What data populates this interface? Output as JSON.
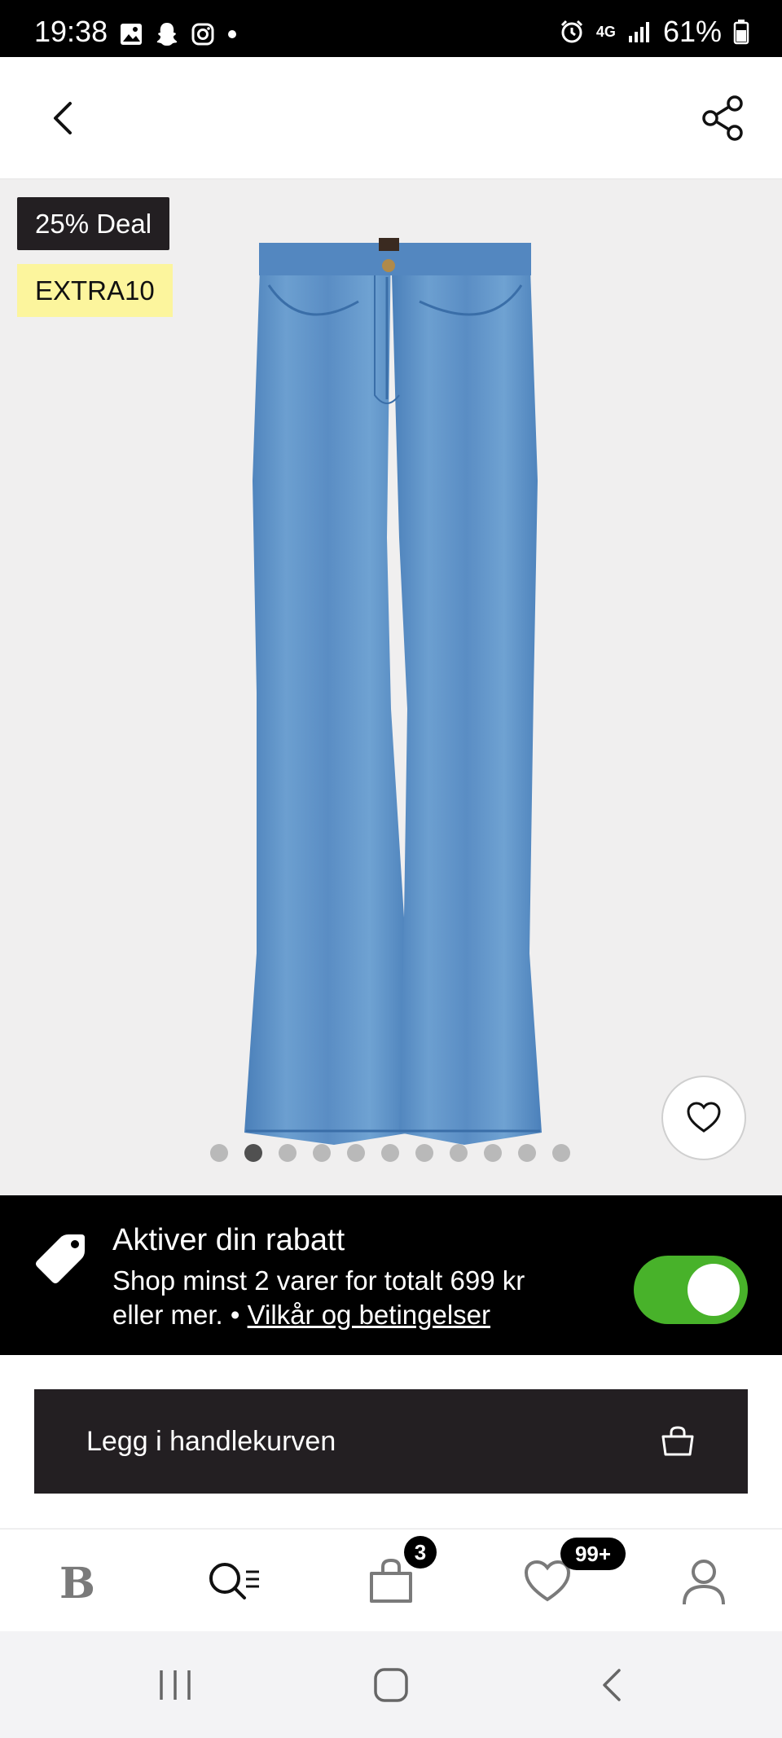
{
  "status_bar": {
    "time": "19:38",
    "network": "4G",
    "battery": "61%"
  },
  "product": {
    "badge_deal": "25% Deal",
    "badge_code": "EXTRA10",
    "image_count": 11,
    "active_image_index": 1
  },
  "promo": {
    "title": "Aktiver din rabatt",
    "line1": "Shop minst 2 varer for totalt 699 kr",
    "line2_prefix": "eller mer. • ",
    "terms_link": "Vilkår og betingelser",
    "toggle_on": true
  },
  "cta": {
    "label": "Legg i handlekurven"
  },
  "bottom_nav": {
    "items": [
      {
        "name": "home",
        "icon": "brand-b-icon"
      },
      {
        "name": "search",
        "icon": "search-list-icon"
      },
      {
        "name": "cart",
        "icon": "bag-icon",
        "badge": "3"
      },
      {
        "name": "favorites",
        "icon": "heart-icon",
        "badge": "99+"
      },
      {
        "name": "account",
        "icon": "person-icon"
      }
    ]
  },
  "colors": {
    "accent_green": "#48b22a",
    "dark": "#231f22",
    "code_badge": "#fcf59d"
  }
}
